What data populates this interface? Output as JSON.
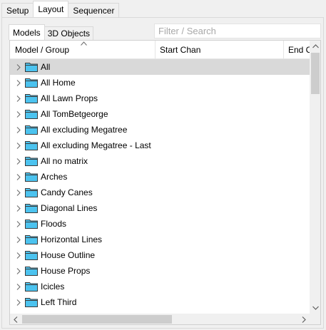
{
  "top_tabs": [
    "Setup",
    "Layout",
    "Sequencer"
  ],
  "inner_tabs": [
    "Models",
    "3D Objects"
  ],
  "search": {
    "placeholder": "Filter / Search"
  },
  "columns": [
    "Model / Group",
    "Start Chan",
    "End C"
  ],
  "folder_color": "#4cc3ef",
  "rows": [
    "All",
    "All Home",
    "All Lawn Props",
    "All TomBetgeorge",
    "All excluding Megatree",
    "All excluding Megatree - Last",
    "All no matrix",
    "Arches",
    "Candy Canes",
    "Diagonal Lines",
    "Floods",
    "Horizontal Lines",
    "House Outline",
    "House Props",
    "Icicles",
    "Left Third"
  ]
}
